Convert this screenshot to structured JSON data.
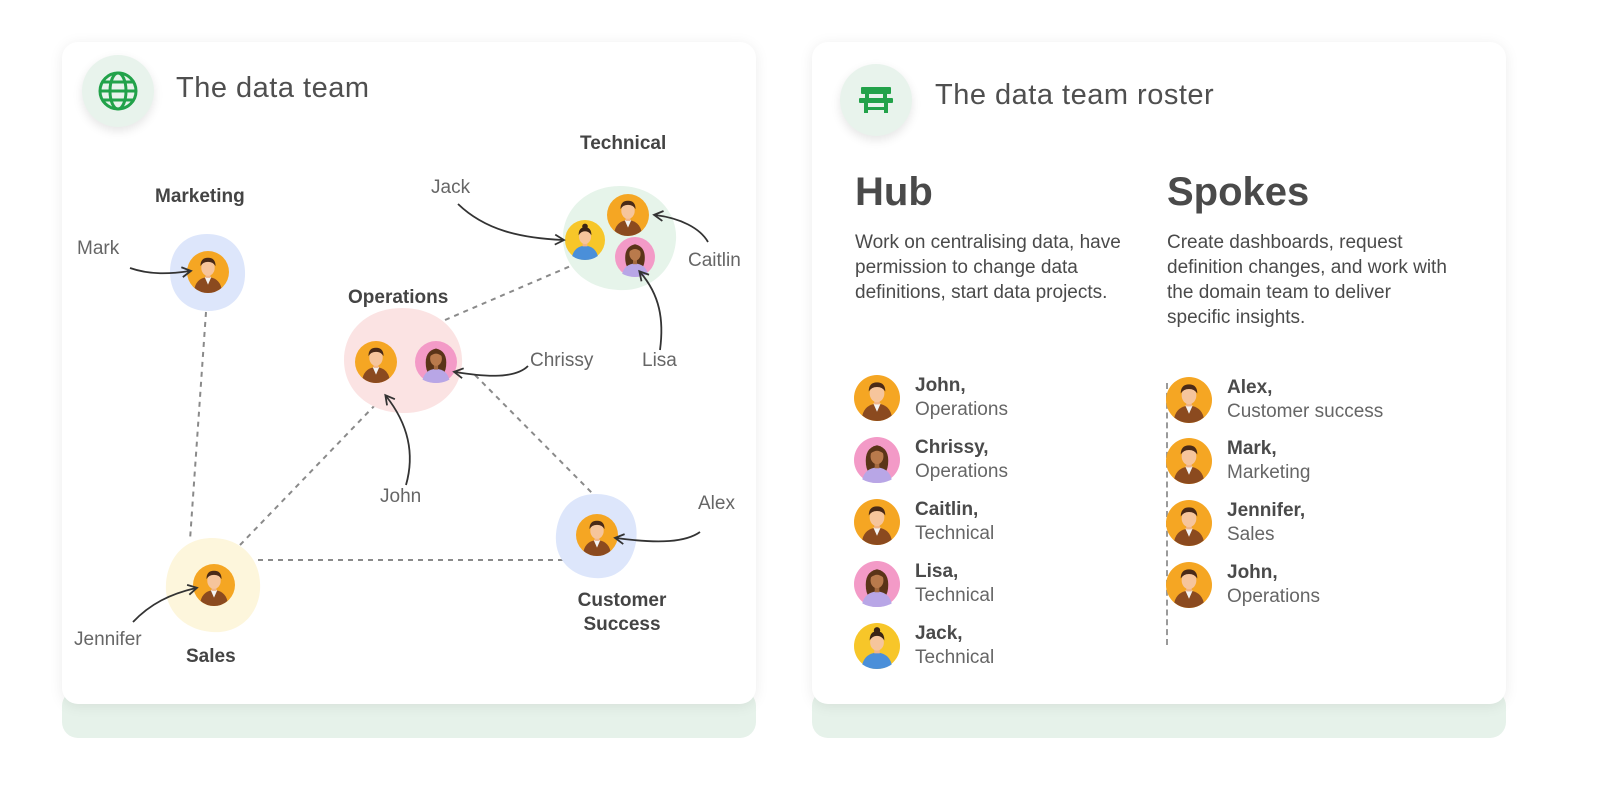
{
  "left_card": {
    "title": "The data team",
    "icon": "globe-icon",
    "accent": "#22a24a",
    "groups": {
      "technical": "Technical",
      "marketing": "Marketing",
      "operations": "Operations",
      "customer_success_line1": "Customer",
      "customer_success_line2": "Success",
      "sales": "Sales"
    },
    "group_colors": {
      "technical": "#e6f4ea",
      "marketing": "#dde6fb",
      "operations": "#fbe3e3",
      "customer_success": "#dde6fb",
      "sales": "#fdf6dc"
    },
    "people": {
      "jack": "Jack",
      "caitlin": "Caitlin",
      "mark": "Mark",
      "chrissy": "Chrissy",
      "lisa": "Lisa",
      "john": "John",
      "alex": "Alex",
      "jennifer": "Jennifer"
    }
  },
  "right_card": {
    "title": "The data team roster",
    "icon": "bench-icon",
    "hub": {
      "title": "Hub",
      "description": "Work on centralising data, have permission to change data definitions, start data projects.",
      "members": [
        {
          "name": "John,",
          "group": "Operations",
          "avatar": "male-avatar"
        },
        {
          "name": "Chrissy,",
          "group": "Operations",
          "avatar": "female-avatar"
        },
        {
          "name": "Caitlin,",
          "group": "Technical",
          "avatar": "male-avatar"
        },
        {
          "name": "Lisa,",
          "group": "Technical",
          "avatar": "female-avatar"
        },
        {
          "name": "Jack,",
          "group": "Technical",
          "avatar": "blue-avatar"
        }
      ]
    },
    "spokes": {
      "title": "Spokes",
      "description": "Create dashboards, request definition changes, and work with the domain team to deliver specific insights.",
      "members": [
        {
          "name": "Alex,",
          "group": "Customer success",
          "avatar": "male-avatar"
        },
        {
          "name": "Mark,",
          "group": "Marketing",
          "avatar": "male-avatar"
        },
        {
          "name": "Jennifer,",
          "group": "Sales",
          "avatar": "male-avatar"
        },
        {
          "name": "John,",
          "group": "Operations",
          "avatar": "male-avatar"
        }
      ]
    }
  }
}
